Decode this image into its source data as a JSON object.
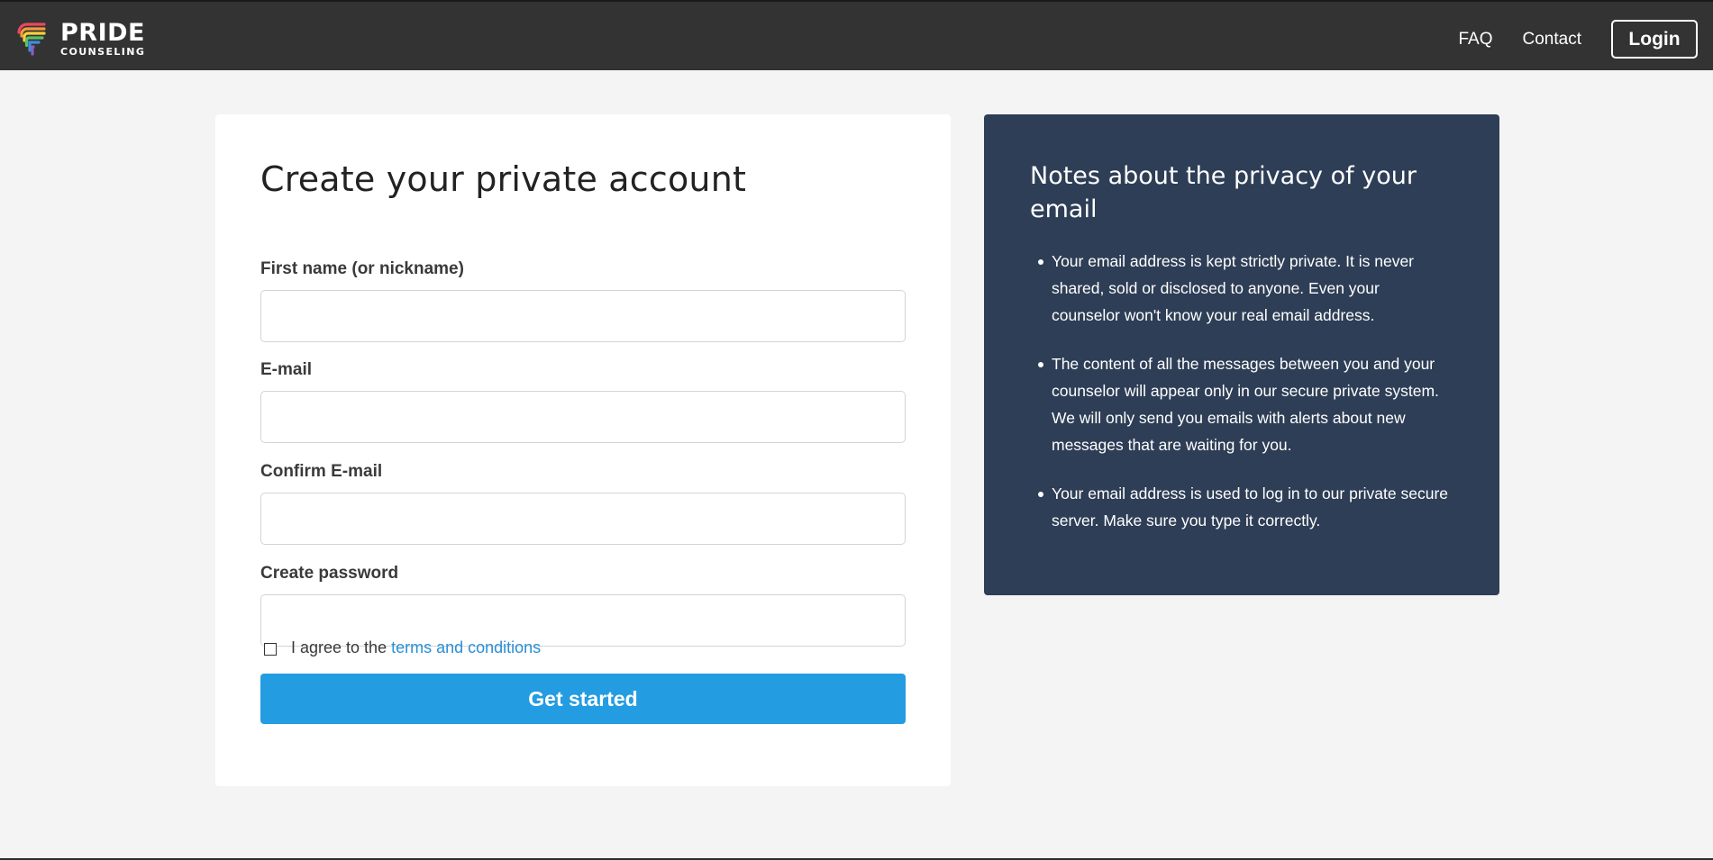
{
  "header": {
    "logo": {
      "primary": "PRIDE",
      "secondary": "COUNSELING",
      "stripe_colors": [
        "#e9495f",
        "#f39a3b",
        "#f5d13b",
        "#5cbf6a",
        "#3d8fd6",
        "#8b5cc2"
      ]
    },
    "nav": {
      "faq_label": "FAQ",
      "contact_label": "Contact",
      "login_label": "Login"
    }
  },
  "form": {
    "title": "Create your private account",
    "fields": {
      "first_name": {
        "label": "First name (or nickname)",
        "value": ""
      },
      "email": {
        "label": "E-mail",
        "value": ""
      },
      "confirm_email": {
        "label": "Confirm E-mail",
        "value": ""
      },
      "password": {
        "label": "Create password",
        "value": ""
      }
    },
    "agree": {
      "prefix": "I agree to the",
      "link_text": "terms and conditions",
      "checked": false
    },
    "submit_label": "Get started"
  },
  "privacy_notes": {
    "title": "Notes about the privacy of your email",
    "items": [
      "Your email address is kept strictly private. It is never shared, sold or disclosed to anyone. Even your counselor won't know your real email address.",
      "The content of all the messages between you and your counselor will appear only in our secure private system. We will only send you emails with alerts about new messages that are waiting for you.",
      "Your email address is used to log in to our private secure server. Make sure you type it correctly."
    ]
  },
  "colors": {
    "header_bg": "#333333",
    "page_bg": "#f4f4f4",
    "info_bg": "#2e3e56",
    "primary_button": "#239ce2",
    "link": "#2a8fd6"
  }
}
